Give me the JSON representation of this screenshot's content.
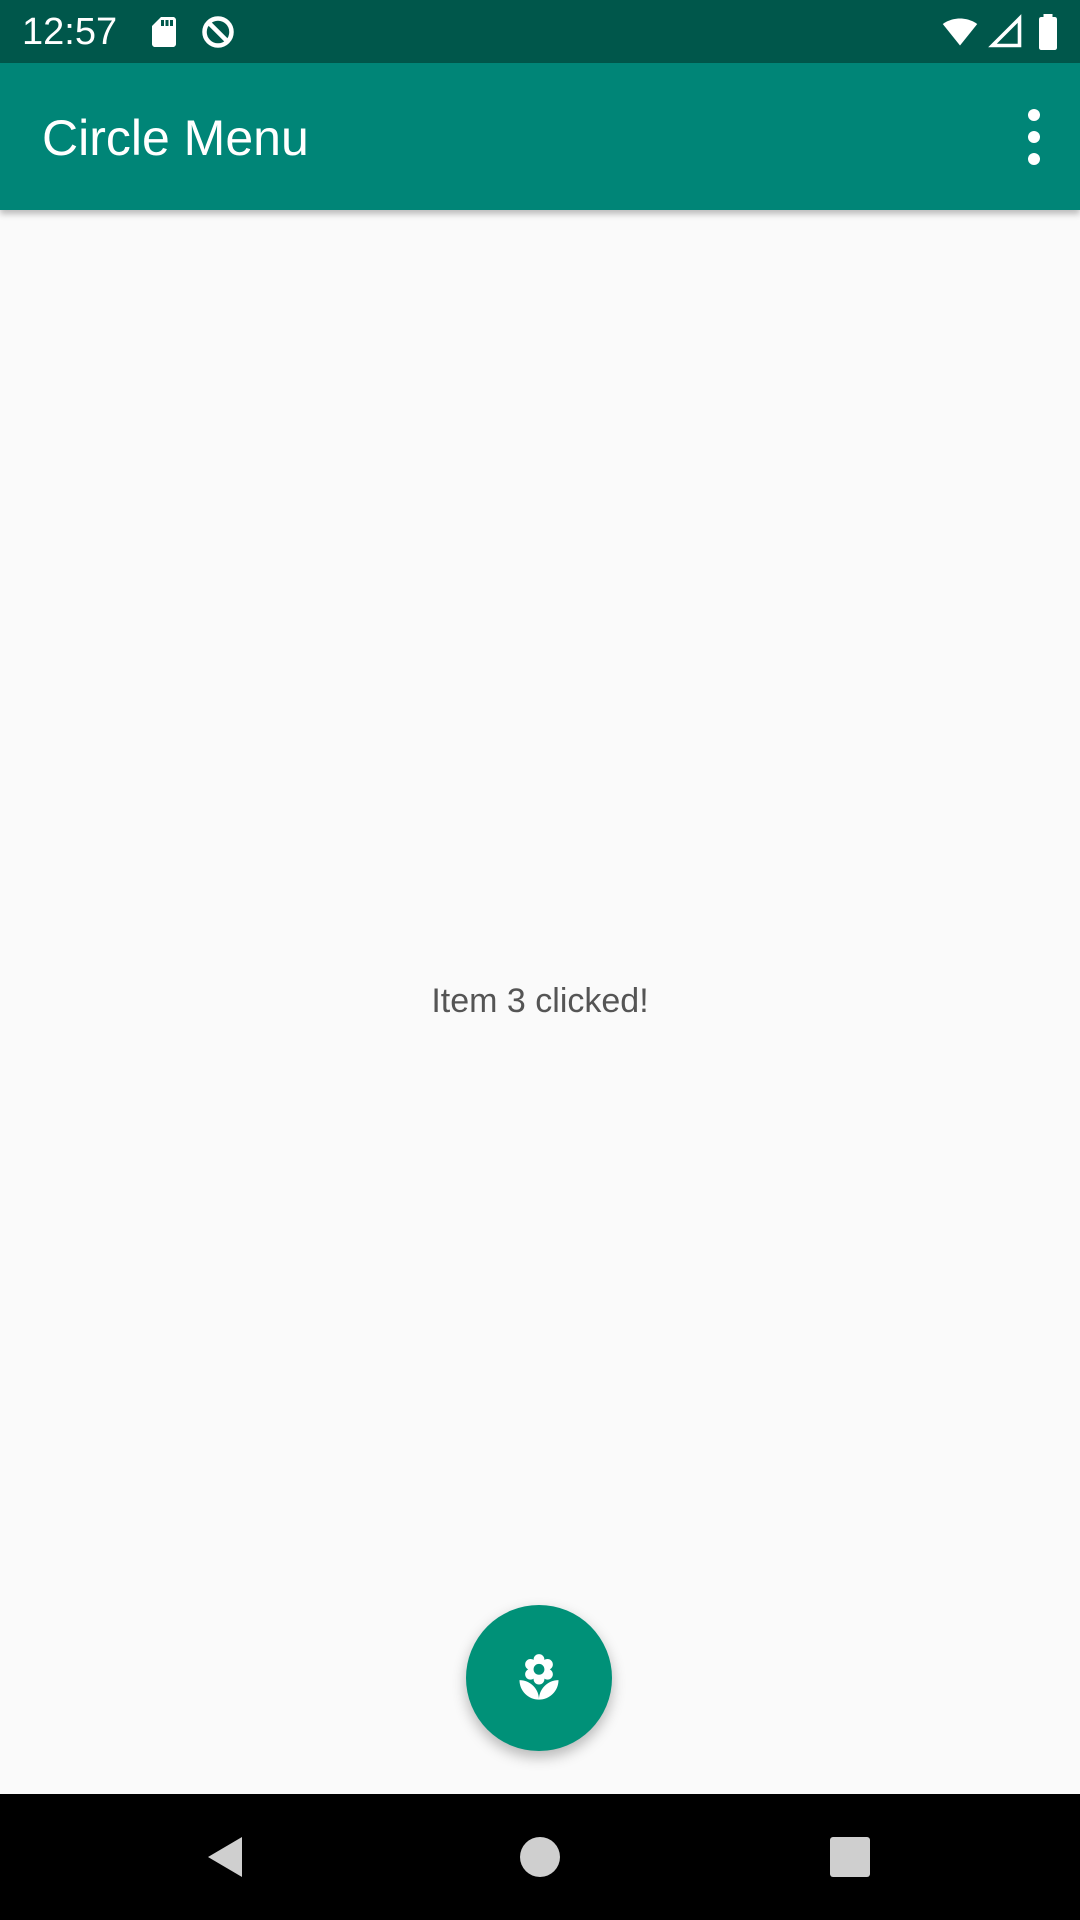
{
  "status_bar": {
    "time": "12:57",
    "icons": [
      "sd-card-icon",
      "data-saver-icon",
      "wifi-icon",
      "cell-signal-icon",
      "battery-icon"
    ],
    "background": "#00574b"
  },
  "app_bar": {
    "title": "Circle Menu",
    "background": "#008577",
    "overflow_icon": "more-vert-icon"
  },
  "content": {
    "message": "Item 3 clicked!"
  },
  "fab": {
    "icon": "local-florist-icon",
    "background": "#009178"
  },
  "nav_bar": {
    "buttons": [
      "back-icon",
      "home-icon",
      "recents-icon"
    ]
  }
}
